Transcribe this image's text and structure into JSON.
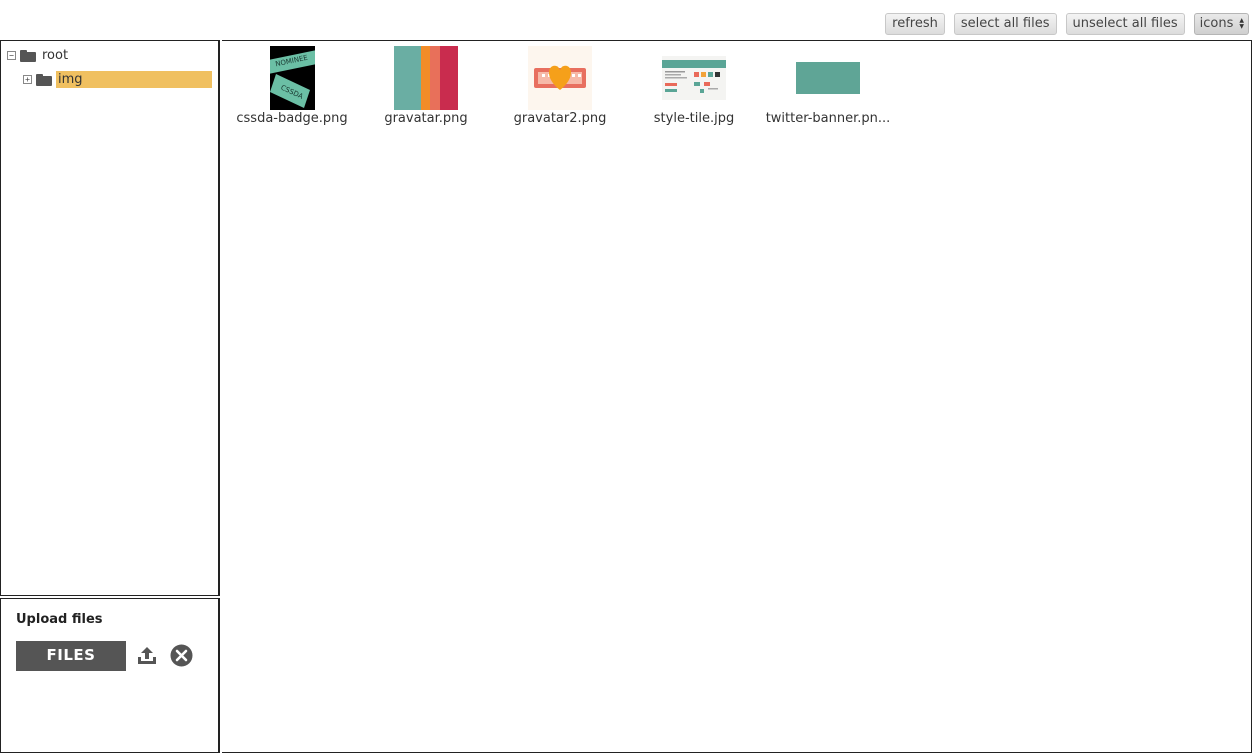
{
  "toolbar": {
    "refresh_label": "refresh",
    "select_all_label": "select all files",
    "unselect_all_label": "unselect all files",
    "view_mode": "icons"
  },
  "tree": {
    "root_label": "root",
    "children": [
      {
        "label": "img",
        "selected": true
      }
    ]
  },
  "upload": {
    "title": "Upload files",
    "files_button": "FILES"
  },
  "files": [
    {
      "name": "cssda-badge.png",
      "badge_top": "NOMINEE",
      "badge_bottom": "CSSDA"
    },
    {
      "name": "gravatar.png"
    },
    {
      "name": "gravatar2.png"
    },
    {
      "name": "style-tile.jpg"
    },
    {
      "name": "twitter-banner.pn..."
    }
  ],
  "colors": {
    "selection": "#f0c060",
    "folder": "#555555",
    "button_dark": "#555555",
    "teal": "#6aaea3"
  }
}
